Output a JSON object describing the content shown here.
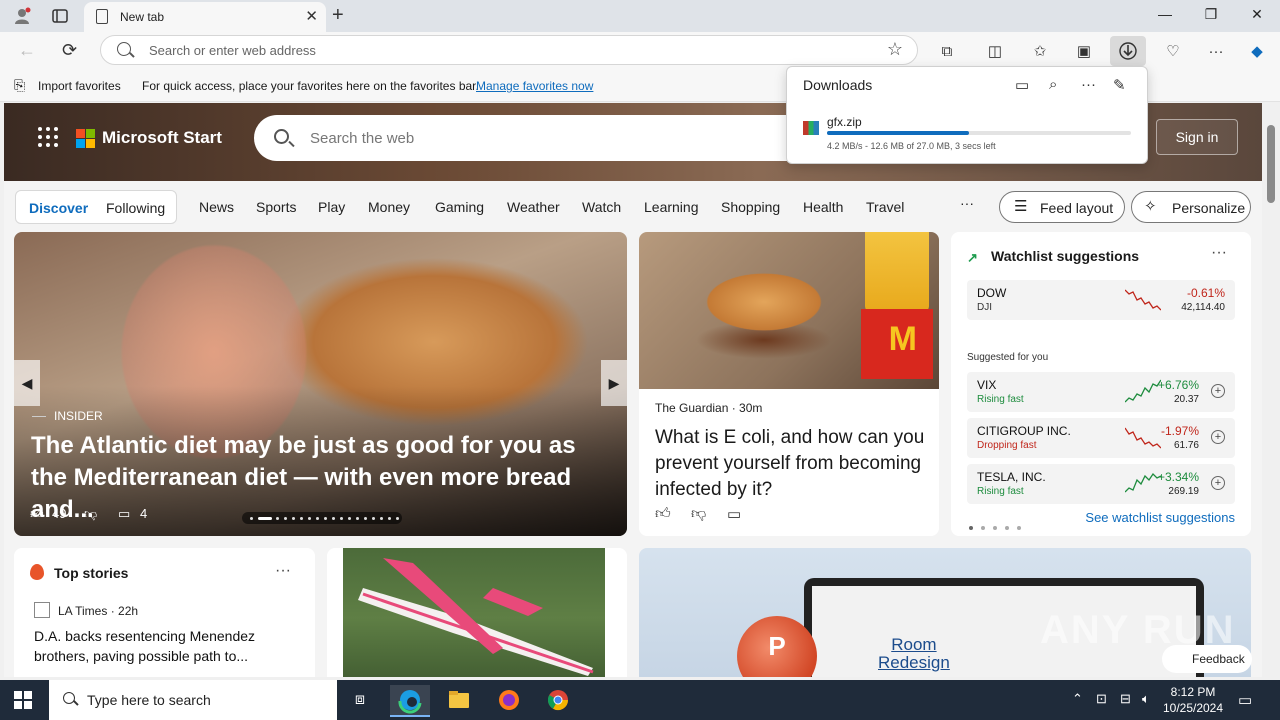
{
  "browser": {
    "tab_title": "New tab",
    "address_placeholder": "Search or enter web address"
  },
  "favorites_bar": {
    "import_label": "Import favorites",
    "hint": "For quick access, place your favorites here on the favorites bar.",
    "manage_link": "Manage favorites now"
  },
  "downloads": {
    "title": "Downloads",
    "file_name": "gfx.zip",
    "progress_fraction": 0.467,
    "status": "4.2 MB/s - 12.6 MB of 27.0 MB, 3 secs left"
  },
  "header": {
    "brand": "Microsoft Start",
    "search_placeholder": "Search the web",
    "sign_in": "Sign in"
  },
  "nav": {
    "discover": "Discover",
    "following": "Following",
    "links": [
      "News",
      "Sports",
      "Play",
      "Money",
      "Gaming",
      "Weather",
      "Watch",
      "Learning",
      "Shopping",
      "Health",
      "Travel"
    ],
    "more": "···",
    "feed_layout": "Feed layout",
    "personalize": "Personalize"
  },
  "hero": {
    "source": "INSIDER",
    "title": "The Atlantic diet may be just as good for you as the Mediterranean diet — with even more bread and...",
    "likes": "49",
    "comments": "4"
  },
  "news": {
    "source": "The Guardian · 30m",
    "title": "What is E coli, and how can you prevent yourself from becoming infected by it?"
  },
  "watchlist": {
    "title": "Watchlist suggestions",
    "more": "···",
    "suggested_label": "Suggested for you",
    "see_link": "See watchlist suggestions",
    "stocks": [
      {
        "symbol": "DOW",
        "sub": "DJI",
        "pct": "-0.61%",
        "value": "42,114.40",
        "color": "#c0261b"
      },
      {
        "symbol": "VIX",
        "sub": "Rising fast",
        "pct": "+6.76%",
        "value": "20.37",
        "color": "#1e8c3e"
      },
      {
        "symbol": "CITIGROUP INC.",
        "sub": "Dropping fast",
        "pct": "-1.97%",
        "value": "61.76",
        "color": "#c0261b"
      },
      {
        "symbol": "TESLA, INC.",
        "sub": "Rising fast",
        "pct": "+3.34%",
        "value": "269.19",
        "color": "#1e8c3e"
      }
    ]
  },
  "top_stories": {
    "title": "Top stories",
    "more": "···",
    "source": "LA Times · 22h",
    "headline": "D.A. backs resentencing Menendez brothers, paving possible path to..."
  },
  "office_card": {
    "room_text_1": "Room",
    "room_text_2": "Redesign"
  },
  "feedback": "Feedback",
  "watermark": "ANY RUN",
  "taskbar": {
    "search_placeholder": "Type here to search",
    "time": "8:12 PM",
    "date": "10/25/2024"
  }
}
